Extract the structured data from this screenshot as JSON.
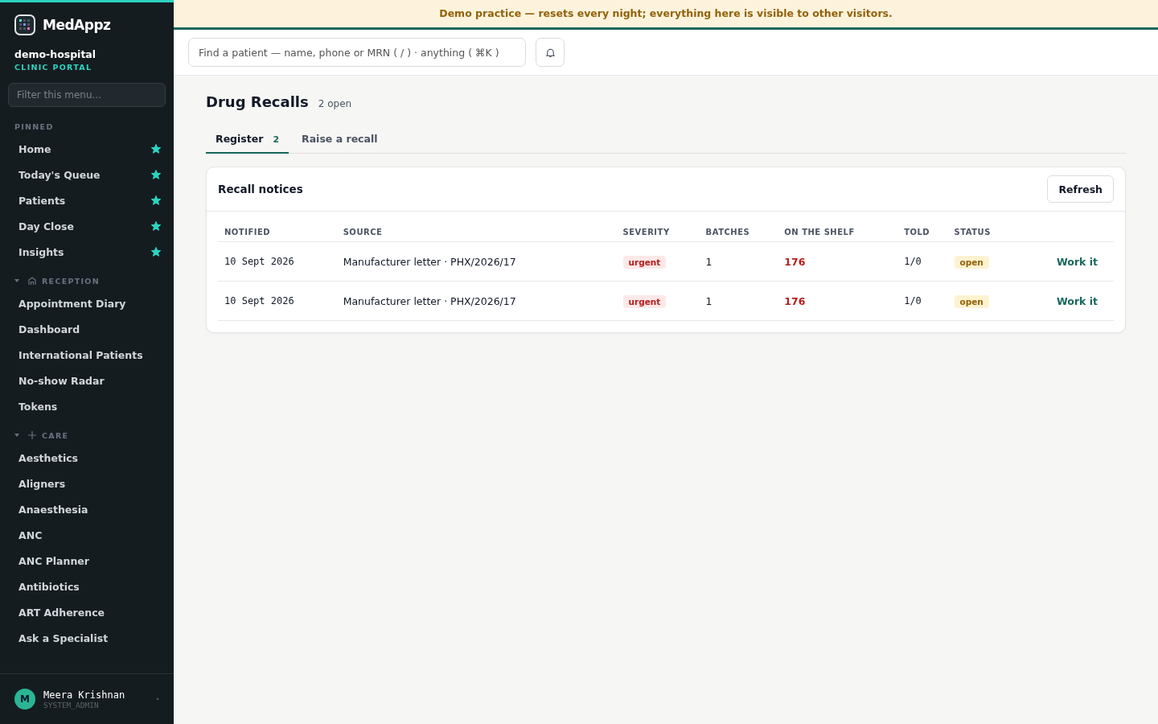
{
  "banner": "Demo practice — resets every night; everything here is visible to other visitors.",
  "sidebar": {
    "brand": "MedAppz",
    "org": "demo-hospital",
    "portal": "CLINIC PORTAL",
    "filter": {
      "placeholder": "Filter this menu..."
    },
    "pinned": {
      "title": "PINNED",
      "items": [
        {
          "label": "Home",
          "starred": true
        },
        {
          "label": "Today's Queue",
          "starred": true
        },
        {
          "label": "Patients",
          "starred": true
        },
        {
          "label": "Day Close",
          "starred": true
        },
        {
          "label": "Insights",
          "starred": true
        }
      ]
    },
    "sections": [
      {
        "title": "RECEPTION",
        "kind": "house",
        "expanded": true,
        "items": [
          "Appointment Diary",
          "Dashboard",
          "International Patients",
          "No-show Radar",
          "Tokens"
        ]
      },
      {
        "title": "CARE",
        "kind": "plus",
        "expanded": true,
        "items": [
          "Aesthetics",
          "Aligners",
          "Anaesthesia",
          "ANC",
          "ANC Planner",
          "Antibiotics",
          "ART Adherence",
          "Ask a Specialist"
        ]
      }
    ],
    "user": {
      "initial": "M",
      "name": "Meera Krishnan",
      "role": "SYSTEM_ADMIN"
    }
  },
  "search": {
    "placeholder": "Find a patient — name, phone or MRN ( / ) · anything ( ⌘K )"
  },
  "page": {
    "title": "Drug Recalls",
    "count": "2 open",
    "tabs": [
      {
        "label": "Register",
        "badge": "2",
        "selected": true
      },
      {
        "label": "Raise a recall",
        "selected": false
      }
    ],
    "card": {
      "title": "Recall notices",
      "refresh": "Refresh",
      "columns": [
        "NOTIFIED",
        "SOURCE",
        "SEVERITY",
        "BATCHES",
        "ON THE SHELF",
        "TOLD",
        "STATUS"
      ],
      "rows": [
        {
          "notified": "10 Sept 2026",
          "source": "Manufacturer letter · PHX/2026/17",
          "severity": "urgent",
          "batches": "1",
          "shelf": "176",
          "told": "1/0",
          "status": "open",
          "action": "Work it"
        },
        {
          "notified": "10 Sept 2026",
          "source": "Manufacturer letter · PHX/2026/17",
          "severity": "urgent",
          "batches": "1",
          "shelf": "176",
          "told": "1/0",
          "status": "open",
          "action": "Work it"
        }
      ]
    }
  }
}
